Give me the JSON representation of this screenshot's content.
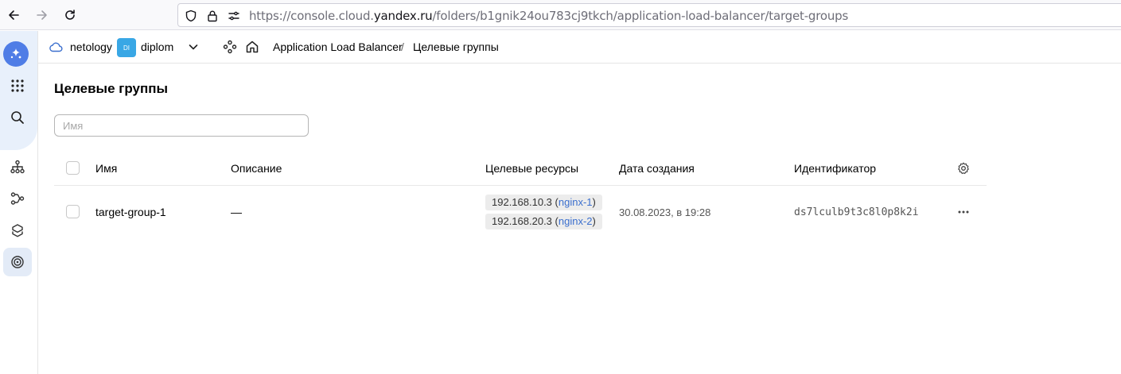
{
  "browser": {
    "url_prefix": "https://console.cloud.",
    "url_domain": "yandex.ru",
    "url_path": "/folders/b1gnik24ou783cj9tkch/application-load-balancer/target-groups"
  },
  "header": {
    "cloud_name": "netology",
    "folder_badge": "DI",
    "folder_name": "diplom",
    "service": "Application Load Balancer",
    "separator": "/",
    "current": "Целевые группы"
  },
  "main": {
    "title": "Целевые группы",
    "search_placeholder": "Имя",
    "columns": [
      "Имя",
      "Описание",
      "Целевые ресурсы",
      "Дата создания",
      "Идентификатор"
    ],
    "rows": [
      {
        "name": "target-group-1",
        "description": "—",
        "resources": [
          {
            "ip": "192.168.10.3",
            "instance": "nginx-1"
          },
          {
            "ip": "192.168.20.3",
            "instance": "nginx-2"
          }
        ],
        "created": "30.08.2023, в 19:28",
        "id": "ds7lculb9t3c8l0p8k2i"
      }
    ]
  },
  "icons": {
    "back": "arrow-left-icon",
    "forward": "arrow-right-icon",
    "reload": "reload-icon",
    "shield": "shield-icon",
    "lock": "lock-icon",
    "permissions": "tune-icon"
  }
}
